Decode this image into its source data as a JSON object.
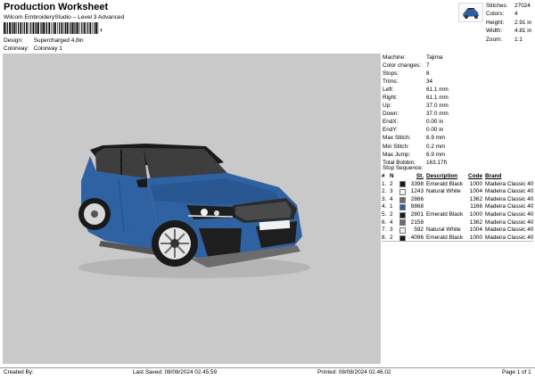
{
  "header": {
    "title": "Production Worksheet",
    "subtitle": "Wilcom EmbroideryStudio – Level 3 Advanced",
    "barcode_suffix": ","
  },
  "meta": {
    "design_label": "Design:",
    "design_value": "Supercharged 4,8in",
    "colorway_label": "Colorway:",
    "colorway_value": "Colorway 1"
  },
  "stats": [
    {
      "label": "Stitches:",
      "value": "27024"
    },
    {
      "label": "Colors:",
      "value": "4"
    },
    {
      "label": "Height:",
      "value": "2.91 in"
    },
    {
      "label": "Width:",
      "value": "4.81 in"
    },
    {
      "label": "Zoom:",
      "value": "1:1"
    }
  ],
  "specs": [
    {
      "label": "Machine:",
      "value": "Tajima"
    },
    {
      "label": "Color changes:",
      "value": "7"
    },
    {
      "label": "Stops:",
      "value": "8"
    },
    {
      "label": "Trims:",
      "value": "34"
    },
    {
      "label": "Left:",
      "value": "61.1 mm"
    },
    {
      "label": "Right:",
      "value": "61.1 mm"
    },
    {
      "label": "Up:",
      "value": "37.0 mm"
    },
    {
      "label": "Down:",
      "value": "37.0 mm"
    },
    {
      "label": "EndX:",
      "value": "0.00 in"
    },
    {
      "label": "EndY:",
      "value": "0.00 in"
    },
    {
      "label": "Max Stitch:",
      "value": "6.9 mm"
    },
    {
      "label": "Min Stitch:",
      "value": "0.2 mm"
    },
    {
      "label": "Max Jump:",
      "value": "6.9 mm"
    },
    {
      "label": "Total Bobbin:",
      "value": "163.17ft"
    }
  ],
  "sequence": {
    "title": "Stop Sequence:",
    "headers": {
      "num": "#",
      "n": "N",
      "st": "St.",
      "desc": "Description",
      "code": "Code",
      "brand": "Brand"
    },
    "rows": [
      {
        "num": "1.",
        "n": "2",
        "color": "#1a1a1a",
        "st": "3398",
        "desc": "Emerald Black",
        "code": "1000",
        "brand": "Madeira Classic 40"
      },
      {
        "num": "2.",
        "n": "3",
        "color": "#f2f2f2",
        "st": "1243",
        "desc": "Natural White",
        "code": "1004",
        "brand": "Madeira Classic 40"
      },
      {
        "num": "3.",
        "n": "4",
        "color": "#6c6c6c",
        "st": "2866",
        "desc": "",
        "code": "1362",
        "brand": "Madeira Classic 40"
      },
      {
        "num": "4.",
        "n": "1",
        "color": "#2d5f9e",
        "st": "8868",
        "desc": "",
        "code": "1166",
        "brand": "Madeira Classic 40"
      },
      {
        "num": "5.",
        "n": "2",
        "color": "#1a1a1a",
        "st": "2801",
        "desc": "Emerald Black",
        "code": "1000",
        "brand": "Madeira Classic 40"
      },
      {
        "num": "6.",
        "n": "4",
        "color": "#6c6c6c",
        "st": "2158",
        "desc": "",
        "code": "1362",
        "brand": "Madeira Classic 40"
      },
      {
        "num": "7.",
        "n": "3",
        "color": "#f2f2f2",
        "st": "592",
        "desc": "Natural White",
        "code": "1004",
        "brand": "Madeira Classic 40"
      },
      {
        "num": "8.",
        "n": "2",
        "color": "#1a1a1a",
        "st": "4096",
        "desc": "Emerald Black",
        "code": "1000",
        "brand": "Madeira Classic 40"
      }
    ]
  },
  "footer": {
    "created_by": "Created By:",
    "last_saved": "Last Saved: 08/08/2024 02.45.59",
    "printed": "Printed: 08/08/2024 02.46.02",
    "page": "Page 1 of 1"
  },
  "colors": {
    "canvas_bg": "#c9c9c9",
    "body_blue": "#2d5f9e",
    "roof_black": "#1a1a1a"
  }
}
